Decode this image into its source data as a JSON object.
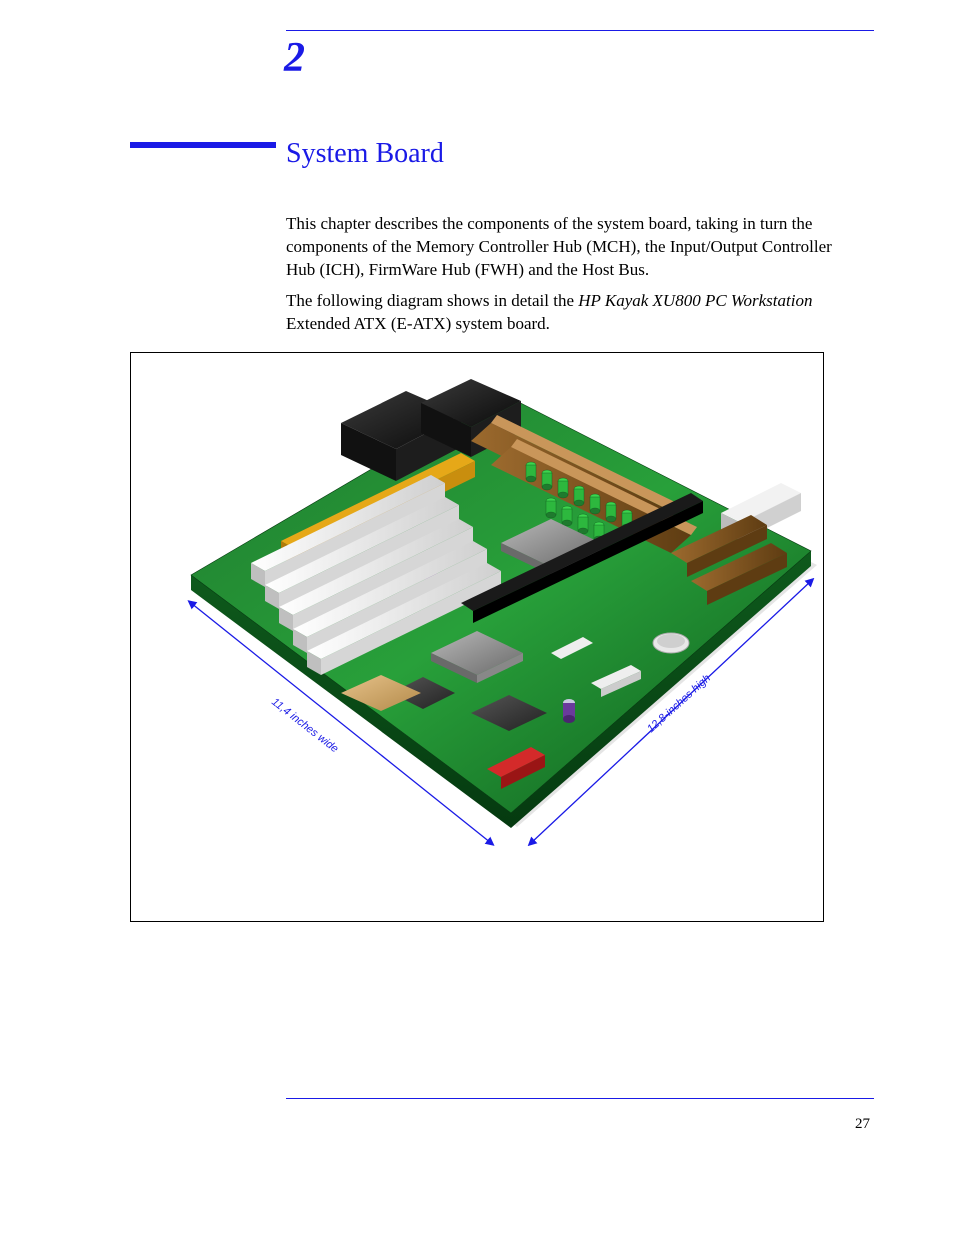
{
  "chapter": {
    "number": "2",
    "title": "System Board"
  },
  "paragraphs": {
    "intro": "This chapter describes the components of the system board, taking in turn the components of the Memory Controller Hub (MCH), the Input/Output Controller Hub (ICH), FirmWare Hub (FWH) and the Host Bus.",
    "diagram_lead": "The following diagram shows in detail the ",
    "product_italic": "HP Kayak XU800 PC Workstation",
    "diagram_trail": " Extended ATX (E-ATX) system board."
  },
  "figure": {
    "dimensions": {
      "width_label": "11,4 inches wide",
      "height_label": "12,8-inches high"
    }
  },
  "page_number": "27"
}
